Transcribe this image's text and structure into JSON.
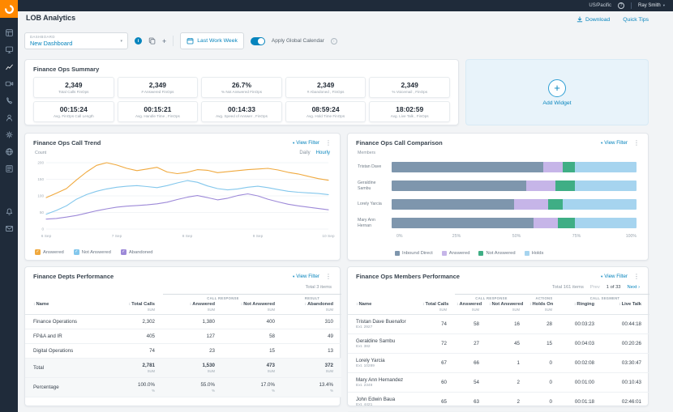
{
  "topbar": {
    "timezone": "US/Pacific",
    "user": "Ray Smith"
  },
  "sidebar": {
    "icons": [
      "dashboard",
      "desktop",
      "analytics",
      "video",
      "phone",
      "contacts",
      "settings",
      "globe",
      "reports",
      "alerts",
      "messages"
    ]
  },
  "header": {
    "title": "LOB Analytics",
    "download": "Download",
    "quick_tips": "Quick Tips"
  },
  "toolbar": {
    "dashboard_label": "DASHBOARD",
    "dashboard_name": "New Dashboard",
    "date_range": "Last Work Week",
    "global_calendar": "Apply Global Calendar"
  },
  "panels": {
    "view_filter": "View Filter"
  },
  "summary": {
    "title": "Finance Ops Summary",
    "cards": [
      {
        "value": "2,349",
        "label": "Total Calls FinOps"
      },
      {
        "value": "2,349",
        "label": "# Answered FinOps"
      },
      {
        "value": "26.7%",
        "label": "% Not Answered FinOps"
      },
      {
        "value": "2,349",
        "label": "# Abandoned , FinOps"
      },
      {
        "value": "2,349",
        "label": "% Voicemail , FinOps"
      },
      {
        "value": "00:15:24",
        "label": "Avg. FinOps Call Length"
      },
      {
        "value": "00:15:21",
        "label": "Avg. Handle Time , FinOps"
      },
      {
        "value": "00:14:33",
        "label": "Avg. Speed of Answer , FinOps"
      },
      {
        "value": "08:59:24",
        "label": "Avg. Hold Time FinOps"
      },
      {
        "value": "18:02:59",
        "label": "Avg. Live Talk , FinOps"
      }
    ]
  },
  "add_widget": {
    "label": "Add Widget"
  },
  "trend": {
    "title": "Finance Ops Call Trend",
    "y_label": "Count",
    "daily": "Daily",
    "hourly": "Hourly"
  },
  "comparison": {
    "title": "Finance Ops Call Comparison",
    "members_label": "Members"
  },
  "depts": {
    "title": "Finance Depts Performance",
    "total_items": "Total 3 items",
    "groups": [
      {
        "label": "CALL RESPONSE",
        "span": 2
      },
      {
        "label": "RESULT",
        "span": 1
      }
    ],
    "columns": [
      {
        "label": "Name"
      },
      {
        "label": "Total Calls",
        "sub": "SUM"
      },
      {
        "label": "Answered",
        "sub": "SUM"
      },
      {
        "label": "Not Answered",
        "sub": "SUM"
      },
      {
        "label": "Abandoned",
        "sub": "SUM"
      }
    ],
    "rows": [
      {
        "name": "Finance Operations",
        "values": [
          "2,302",
          "1,380",
          "400",
          "310"
        ]
      },
      {
        "name": "FP&A and IR",
        "values": [
          "405",
          "127",
          "58",
          "49"
        ]
      },
      {
        "name": "Digital Operations",
        "values": [
          "74",
          "23",
          "15",
          "13"
        ]
      },
      {
        "name": "Total",
        "values": [
          "2,781",
          "1,530",
          "473",
          "372"
        ],
        "sub": "SUM",
        "emphasis": true,
        "bold": true
      },
      {
        "name": "Percentage",
        "values": [
          "100.0%",
          "55.0%",
          "17.0%",
          "13.4%"
        ],
        "sub": "%",
        "emphasis": true
      }
    ]
  },
  "members": {
    "title": "Finance Ops Members Performance",
    "total_items": "Total 161 items",
    "pager": {
      "prev": "Prev",
      "page": "1 of 33",
      "next": "Next"
    },
    "groups": [
      {
        "label": "CALL RESPONSE",
        "span": 2
      },
      {
        "label": "ACTIONS",
        "span": 1
      },
      {
        "label": "CALL SEGMENT",
        "span": 2
      }
    ],
    "columns": [
      {
        "label": "Name"
      },
      {
        "label": "Total Calls",
        "sub": "SUM"
      },
      {
        "label": "Answered",
        "sub": "SUM"
      },
      {
        "label": "Not Answered",
        "sub": "SUM"
      },
      {
        "label": "Holds On",
        "sub": "SUM"
      },
      {
        "label": "Ringing"
      },
      {
        "label": "Live Talk"
      }
    ],
    "rows": [
      {
        "name": "Tristan Dave Buenafor",
        "ext": "Ext. 2927",
        "values": [
          "74",
          "58",
          "16",
          "28",
          "00:03:23",
          "00:44:18"
        ]
      },
      {
        "name": "Geraldine Sambu",
        "ext": "Ext. 382",
        "values": [
          "72",
          "27",
          "45",
          "15",
          "00:04:03",
          "00:20:26"
        ]
      },
      {
        "name": "Lorely Yarcia",
        "ext": "Ext. 10289",
        "values": [
          "67",
          "66",
          "1",
          "0",
          "00:02:08",
          "03:30:47"
        ]
      },
      {
        "name": "Mary Ann Hernandez",
        "ext": "Ext. 2349",
        "values": [
          "60",
          "54",
          "2",
          "0",
          "00:01:00",
          "00:10:43"
        ]
      },
      {
        "name": "John Edwin Baua",
        "ext": "Ext. 4421",
        "values": [
          "65",
          "63",
          "2",
          "0",
          "00:01:18",
          "02:46:01"
        ]
      }
    ]
  },
  "chart_data": [
    {
      "type": "line",
      "title": "Finance Ops Call Trend",
      "xlabel": "",
      "ylabel": "Count",
      "ylim": [
        0,
        200
      ],
      "yticks": [
        0,
        50,
        100,
        150,
        200
      ],
      "x_tick_labels": [
        "6 Sep",
        "7 Sep",
        "8 Sep",
        "9 Sep",
        "10 Sep"
      ],
      "x_tick_index": [
        0,
        7,
        14,
        21,
        28
      ],
      "granularity": "Hourly",
      "grid": "horizontal",
      "legend_position": "bottom",
      "series": [
        {
          "name": "Answered",
          "color": "#f0a93e",
          "values": [
            95,
            108,
            122,
            148,
            172,
            192,
            200,
            193,
            183,
            176,
            181,
            186,
            172,
            167,
            171,
            179,
            177,
            170,
            173,
            176,
            179,
            181,
            183,
            178,
            171,
            166,
            159,
            152,
            147
          ]
        },
        {
          "name": "Not Answered",
          "color": "#83c7ec",
          "values": [
            45,
            56,
            70,
            90,
            104,
            114,
            121,
            126,
            129,
            131,
            128,
            125,
            131,
            139,
            146,
            141,
            130,
            122,
            118,
            121,
            126,
            129,
            125,
            119,
            114,
            111,
            109,
            107,
            104
          ]
        },
        {
          "name": "Abandoned",
          "color": "#9d89d8",
          "values": [
            30,
            32,
            36,
            41,
            48,
            55,
            61,
            66,
            69,
            71,
            73,
            76,
            81,
            89,
            96,
            101,
            95,
            88,
            93,
            101,
            106,
            100,
            90,
            82,
            75,
            70,
            66,
            62,
            58
          ]
        }
      ]
    },
    {
      "type": "bar",
      "orientation": "horizontal",
      "stacked": true,
      "title": "Finance Ops Call Comparison",
      "categories": [
        "Tristan Dave",
        "Geraldine Sambu",
        "Lorely Yarcia",
        "Mary Ann Hernan"
      ],
      "x_tick_labels": [
        "0%",
        "25%",
        "50%",
        "75%",
        "100%"
      ],
      "xlim": [
        0,
        100
      ],
      "legend_position": "bottom",
      "series": [
        {
          "name": "Inbound Direct",
          "color": "#7e96ad",
          "values": [
            62,
            55,
            50,
            58
          ]
        },
        {
          "name": "Answered",
          "color": "#c6b5e8",
          "values": [
            8,
            12,
            14,
            10
          ]
        },
        {
          "name": "Not Answered",
          "color": "#3fae85",
          "values": [
            5,
            8,
            6,
            7
          ]
        },
        {
          "name": "Holds",
          "color": "#a6d4ef",
          "values": [
            25,
            25,
            30,
            25
          ]
        }
      ]
    }
  ]
}
